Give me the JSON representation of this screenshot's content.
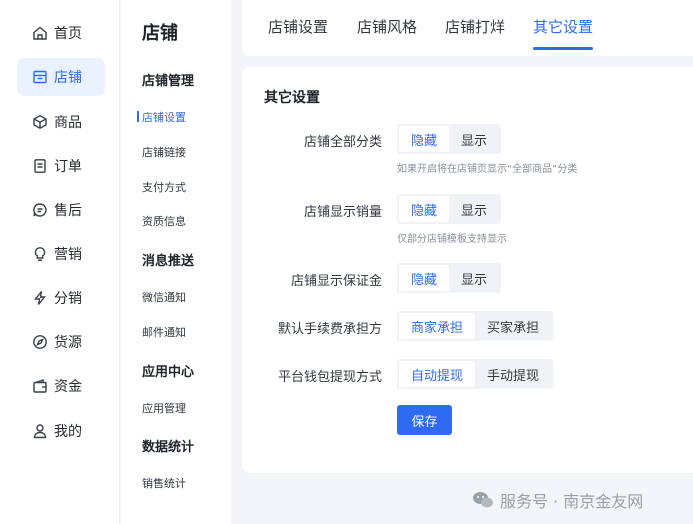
{
  "left_nav": {
    "items": [
      {
        "label": "首页",
        "icon": "home-icon"
      },
      {
        "label": "店铺",
        "icon": "store-icon",
        "active": true
      },
      {
        "label": "商品",
        "icon": "cube-icon"
      },
      {
        "label": "订单",
        "icon": "order-icon"
      },
      {
        "label": "售后",
        "icon": "after-sales-icon"
      },
      {
        "label": "营销",
        "icon": "bulb-icon"
      },
      {
        "label": "分销",
        "icon": "lightning-icon"
      },
      {
        "label": "货源",
        "icon": "compass-icon"
      },
      {
        "label": "资金",
        "icon": "wallet-icon"
      },
      {
        "label": "我的",
        "icon": "user-icon"
      }
    ]
  },
  "sub_nav": {
    "title": "店铺",
    "groups": [
      {
        "title": "店铺管理",
        "links": [
          "店铺设置",
          "店铺链接",
          "支付方式",
          "资质信息"
        ]
      },
      {
        "title": "消息推送",
        "links": [
          "微信通知",
          "邮件通知"
        ]
      },
      {
        "title": "应用中心",
        "links": [
          "应用管理"
        ]
      },
      {
        "title": "数据统计",
        "links": [
          "销售统计"
        ]
      }
    ],
    "active_link": "店铺设置"
  },
  "tabs": {
    "items": [
      "店铺设置",
      "店铺风格",
      "店铺打烊",
      "其它设置"
    ],
    "active": "其它设置"
  },
  "panel": {
    "title": "其它设置",
    "rows": [
      {
        "label": "店铺全部分类",
        "options": [
          "隐藏",
          "显示"
        ],
        "selected": "隐藏",
        "hint": "如果开启将在店铺页显示“全部商品”分类"
      },
      {
        "label": "店铺显示销量",
        "options": [
          "隐藏",
          "显示"
        ],
        "selected": "隐藏",
        "hint": "仅部分店铺模板支持显示"
      },
      {
        "label": "店铺显示保证金",
        "options": [
          "隐藏",
          "显示"
        ],
        "selected": "隐藏",
        "hint": ""
      },
      {
        "label": "默认手续费承担方",
        "options": [
          "商家承担",
          "买家承担"
        ],
        "selected": "商家承担",
        "hint": ""
      },
      {
        "label": "平台钱包提现方式",
        "options": [
          "自动提现",
          "手动提现"
        ],
        "selected": "自动提现",
        "hint": ""
      }
    ],
    "save_label": "保存"
  },
  "watermark": {
    "text": "服务号 · 南京金友网"
  },
  "colors": {
    "accent": "#2f6bf2",
    "background": "#f3f5f9"
  }
}
